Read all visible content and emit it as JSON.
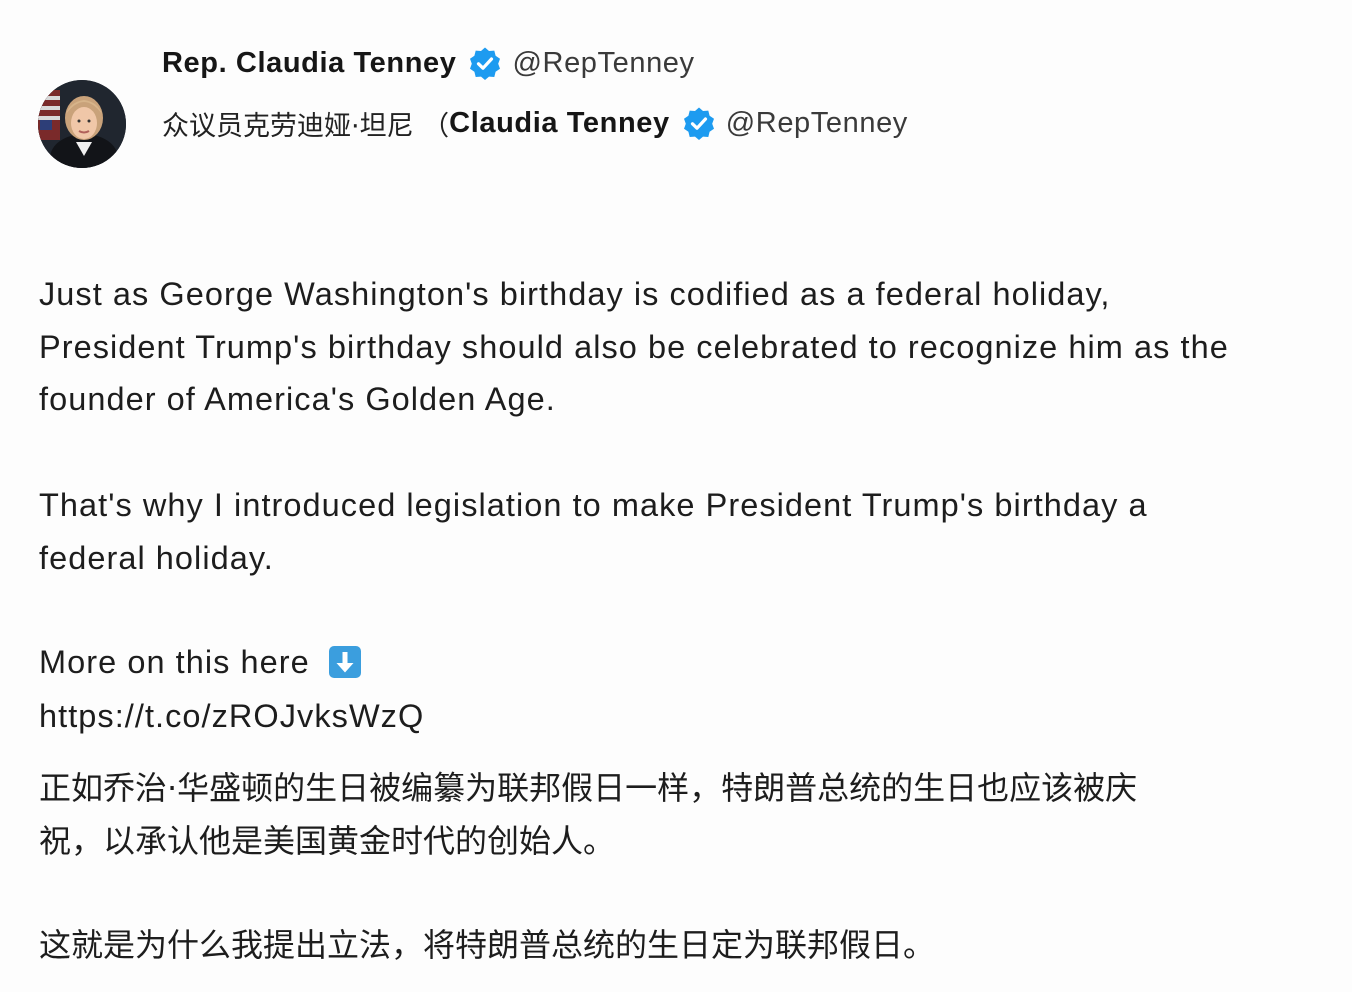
{
  "author": {
    "display_name": "Rep. Claudia Tenney",
    "handle": "@RepTenney",
    "cn_line_prefix": "众议员克劳迪娅·坦尼 （",
    "cn_line_name": "Claudia Tenney",
    "cn_line_handle": "@RepTenney",
    "verified": true,
    "verified_color": "#1d9bf0"
  },
  "tweet": {
    "paragraph_1": "Just as George Washington's birthday is codified as a federal holiday,\nPresident Trump's birthday should also be celebrated to recognize him as the\nfounder of America's Golden Age.",
    "paragraph_2": "That's why I introduced legislation to make President Trump's birthday a\nfederal holiday.",
    "more_text": "More on this here",
    "more_icon": "down-arrow-emoji-icon",
    "link": "https://t.co/zROJvksWzQ"
  },
  "translation": {
    "paragraph_1": "正如乔治·华盛顿的生日被编纂为联邦假日一样，特朗普总统的生日也应该被庆\n祝，以承认他是美国黄金时代的创始人。",
    "paragraph_2": "这就是为什么我提出立法，将特朗普总统的生日定为联邦假日。"
  },
  "colors": {
    "background": "#fdfdfd",
    "text": "#1d1d1d",
    "verified_badge": "#1d9bf0",
    "arrow_emoji_bg": "#3b9ede"
  }
}
